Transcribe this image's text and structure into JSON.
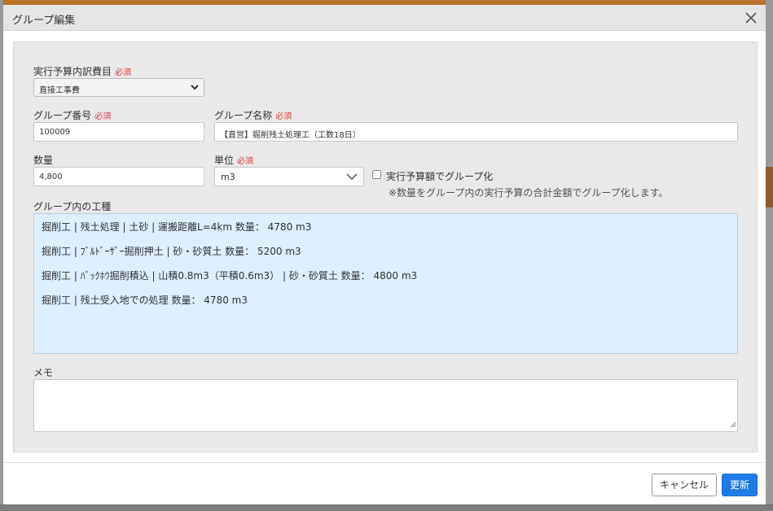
{
  "modal": {
    "title": "グループ編集"
  },
  "form": {
    "cost_item": {
      "label": "実行予算内訳費目",
      "required": "必須",
      "value": "直接工事費"
    },
    "group_number": {
      "label": "グループ番号",
      "required": "必須",
      "value": "100009"
    },
    "group_name": {
      "label": "グループ名称",
      "required": "必須",
      "value": "【直営】掘削残土処理工（工数18日）"
    },
    "quantity": {
      "label": "数量",
      "value": "4,800"
    },
    "unit": {
      "label": "単位",
      "required": "必須",
      "value": "m3"
    },
    "group_by_budget": {
      "label": "実行予算額でグループ化",
      "checked": false,
      "note": "※数量をグループ内の実行予算の合計金額でグループ化します。"
    },
    "work_items": {
      "label": "グループ内の工種",
      "items": [
        "掘削工 | 残土処理 | 土砂 | 運搬距離L=4km 数量： 4780 m3",
        "掘削工 | ﾌﾞﾙﾄﾞｰｻﾞｰ掘削押土 | 砂・砂質土 数量： 5200 m3",
        "掘削工 | ﾊﾞｯｸﾎｳ掘削積込 | 山積0.8m3（平積0.6m3） | 砂・砂質土 数量： 4800 m3",
        "掘削工 | 残土受入地での処理 数量： 4780 m3"
      ]
    },
    "memo": {
      "label": "メモ",
      "value": ""
    }
  },
  "footer": {
    "cancel_label": "キャンセル",
    "update_label": "更新"
  },
  "colors": {
    "primary": "#1e7ce6",
    "required": "#e53935",
    "items_bg": "#ddeeff",
    "header_bg": "#e5e5e5"
  },
  "icons": {
    "close": "close-icon",
    "select_chevron": "chevron-down-icon"
  }
}
